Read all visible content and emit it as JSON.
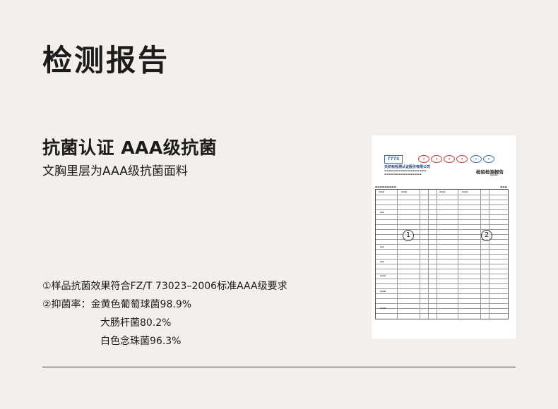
{
  "page": {
    "title": "检测报告",
    "subtitle": "抗菌认证 AAA级抗菌",
    "subline": "文胸里层为AAA级抗菌面料"
  },
  "notes": {
    "line1": "①样品抗菌效果符合FZ/T 73023–2006标准AAA级要求",
    "line2_label": "②抑菌率：",
    "items": [
      "金黄色葡萄球菌98.9%",
      "大肠杆菌80.2%",
      "白色念珠菌96.3%"
    ]
  },
  "report": {
    "logo": "TTTS",
    "org": "天纺标检测认证股份有限公司",
    "title": "检验检测报告",
    "markers": [
      "1",
      "2"
    ]
  },
  "colors": {
    "background": "#f3efea",
    "rule": "#3a3a3a"
  }
}
